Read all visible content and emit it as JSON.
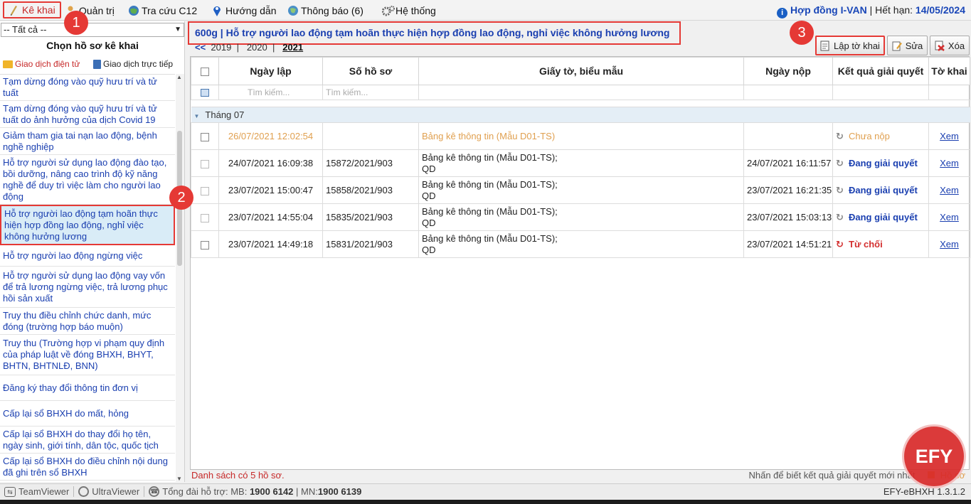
{
  "menu": {
    "ke_khai": "Kê khai",
    "quan_tri": "Quản trị",
    "tra_cuu": "Tra cứu C12",
    "huong_dan": "Hướng dẫn",
    "thong_bao": "Thông báo (6)",
    "he_thong": "Hệ thống"
  },
  "contract": {
    "label": "Hợp đồng I-VAN",
    "expiry_label": "| Hết hạn:",
    "expiry_date": "14/05/2024"
  },
  "badges": {
    "b1": "1",
    "b2": "2",
    "b3": "3"
  },
  "sidebar": {
    "filter_value": "-- Tất cả --",
    "title": "Chọn hồ sơ kê khai",
    "tab_electronic": "Giao dịch điện tử",
    "tab_direct": "Giao dịch trực tiếp",
    "items": [
      {
        "label": "Tạm dừng đóng vào quỹ hưu trí và tử tuất"
      },
      {
        "label": "Tạm dừng đóng vào quỹ hưu trí và tử tuất do ảnh hưởng của dịch Covid 19"
      },
      {
        "label": "Giảm tham gia tai nạn lao động, bệnh nghề nghiệp"
      },
      {
        "label": "Hỗ trợ người sử dụng lao động đào tạo, bồi dưỡng, nâng cao trình độ kỹ năng nghề để duy trì việc làm cho người lao động"
      },
      {
        "label": "Hỗ trợ người lao động tạm hoãn thực hiện hợp đồng lao động, nghỉ việc không hưởng lương"
      },
      {
        "label": "Hỗ trợ người lao động ngừng việc"
      },
      {
        "label": "Hỗ trợ người sử dụng lao động vay vốn để trả lương ngừng việc, trả lương phục hồi sản xuất"
      },
      {
        "label": "Truy thu điều chỉnh chức danh, mức đóng (trường hợp báo muộn)"
      },
      {
        "label": "Truy thu (Trường hợp vi phạm quy định của pháp luật về đóng BHXH, BHYT, BHTN, BHTNLĐ, BNN)"
      },
      {
        "label": "Đăng ký thay đổi thông tin đơn vị"
      },
      {
        "label": "Cấp lại sổ BHXH do mất, hỏng"
      },
      {
        "label": "Cấp lại sổ BHXH do thay đổi họ tên, ngày sinh, giới tính, dân tộc, quốc tịch"
      },
      {
        "label": "Cấp lại sổ BHXH do điều chỉnh nội dung đã ghi trên sổ BHXH"
      }
    ]
  },
  "form": {
    "title": "600g | Hỗ trợ người lao động tạm hoãn thực hiện hợp đồng lao động, nghỉ việc không hưởng lương"
  },
  "years": {
    "prev": "<<",
    "y1": "2019",
    "sep": "|",
    "y2": "2020",
    "y3": "2021"
  },
  "toolbar": {
    "create": "Lập tờ khai",
    "edit": "Sửa",
    "delete": "Xóa"
  },
  "table": {
    "headers": {
      "date_created": "Ngày lập",
      "file_no": "Số hồ sơ",
      "documents": "Giấy tờ, biểu mẫu",
      "date_submitted": "Ngày nộp",
      "result": "Kết quả giải quyết",
      "declaration": "Tờ khai"
    },
    "search_placeholder": "Tìm kiếm...",
    "group": "Tháng 07",
    "rows": [
      {
        "date_created": "26/07/2021 12:02:54",
        "file_no": "",
        "doc1": "Bảng kê thông tin (Mẫu D01-TS)",
        "doc2": "",
        "date_submitted": "",
        "result": "Chưa nộp",
        "view": "Xem"
      },
      {
        "date_created": "24/07/2021 16:09:38",
        "file_no": "15872/2021/903",
        "doc1": "Bảng kê thông tin (Mẫu D01-TS);",
        "doc2": "QD",
        "date_submitted": "24/07/2021 16:11:57",
        "result": "Đang giải quyết",
        "view": "Xem"
      },
      {
        "date_created": "23/07/2021 15:00:47",
        "file_no": "15858/2021/903",
        "doc1": "Bảng kê thông tin (Mẫu D01-TS);",
        "doc2": "QD",
        "date_submitted": "23/07/2021 16:21:35",
        "result": "Đang giải quyết",
        "view": "Xem"
      },
      {
        "date_created": "23/07/2021 14:55:04",
        "file_no": "15835/2021/903",
        "doc1": "Bảng kê thông tin (Mẫu D01-TS);",
        "doc2": "QD",
        "date_submitted": "23/07/2021 15:03:13",
        "result": "Đang giải quyết",
        "view": "Xem"
      },
      {
        "date_created": "23/07/2021 14:49:18",
        "file_no": "15831/2021/903",
        "doc1": "Bảng kê thông tin (Mẫu D01-TS);",
        "doc2": "QD",
        "date_submitted": "23/07/2021 14:51:21",
        "result": "Từ chối",
        "view": "Xem"
      }
    ]
  },
  "status": {
    "count": "Danh sách có 5 hồ sơ.",
    "hint": "Nhấn để biết kết quả giải quyết mới nhất",
    "legend": "Hồ sơ"
  },
  "bottom": {
    "teamviewer": "TeamViewer",
    "ultraviewer": "UltraViewer",
    "hotline_label": "Tổng đài hỗ trợ: MB:",
    "mb": "1900 6142",
    "mn_label": "| MN:",
    "mn": "1900 6139",
    "version": "EFY-eBHXH 1.3.1.2"
  },
  "logo": "EFY",
  "colors": {
    "accent": "#1a3fb0",
    "highlight": "#e53935",
    "pending": "#e0a050",
    "processing": "#1a3fb0",
    "rejected": "#d32f2f"
  }
}
